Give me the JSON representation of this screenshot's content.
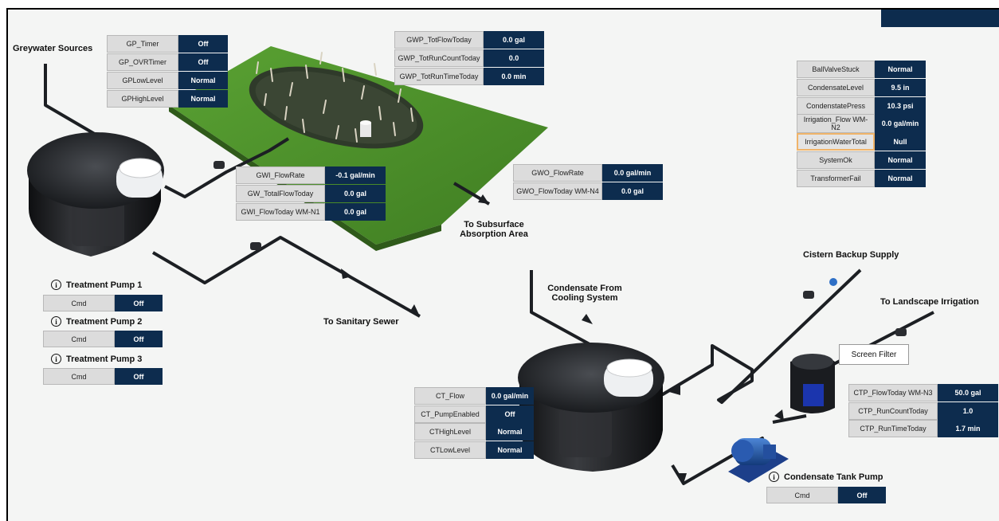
{
  "sources": {
    "greywater": "Greywater Sources",
    "sanitary": "To Sanitary Sewer",
    "subsurface_1": "To Subsurface",
    "subsurface_2": "Absorption Area",
    "condensate_1": "Condensate From",
    "condensate_2": "Cooling System",
    "cistern": "Cistern Backup Supply",
    "landscape": "To Landscape Irrigation",
    "screen_filter": "Screen Filter"
  },
  "gp_tags": [
    {
      "name": "GP_Timer",
      "value": "Off"
    },
    {
      "name": "GP_OVRTimer",
      "value": "Off"
    },
    {
      "name": "GPLowLevel",
      "value": "Normal"
    },
    {
      "name": "GPHighLevel",
      "value": "Normal"
    }
  ],
  "gwp_tags": [
    {
      "name": "GWP_TotFlowToday",
      "value": "0.0 gal"
    },
    {
      "name": "GWP_TotRunCountToday",
      "value": "0.0"
    },
    {
      "name": "GWP_TotRunTimeToday",
      "value": "0.0 min"
    }
  ],
  "gwi_tags": [
    {
      "name": "GWI_FlowRate",
      "value": "-0.1 gal/min"
    },
    {
      "name": "GW_TotalFlowToday",
      "value": "0.0 gal"
    },
    {
      "name": "GWI_FlowToday WM-N1",
      "value": "0.0 gal"
    }
  ],
  "gwo_tags": [
    {
      "name": "GWO_FlowRate",
      "value": "0.0 gal/min"
    },
    {
      "name": "GWO_FlowToday WM-N4",
      "value": "0.0 gal"
    }
  ],
  "system_tags": [
    {
      "name": "BallValveStuck",
      "value": "Normal"
    },
    {
      "name": "CondensateLevel",
      "value": "9.5 in"
    },
    {
      "name": "CondenstatePress",
      "value": "10.3 psi"
    },
    {
      "name": "Irrigation_Flow WM-N2",
      "value": "0.0 gal/min"
    },
    {
      "name": "IrrigationWaterTotal",
      "value": "Null"
    },
    {
      "name": "SystemOk",
      "value": "Normal"
    },
    {
      "name": "TransformerFail",
      "value": "Normal"
    }
  ],
  "ct_tags": [
    {
      "name": "CT_Flow",
      "value": "0.0 gal/min"
    },
    {
      "name": "CT_PumpEnabled",
      "value": "Off"
    },
    {
      "name": "CTHighLevel",
      "value": "Normal"
    },
    {
      "name": "CTLowLevel",
      "value": "Normal"
    }
  ],
  "ctp_tags": [
    {
      "name": "CTP_FlowToday WM-N3",
      "value": "50.0 gal"
    },
    {
      "name": "CTP_RunCountToday",
      "value": "1.0"
    },
    {
      "name": "CTP_RunTimeToday",
      "value": "1.7 min"
    }
  ],
  "pumps": [
    {
      "title": "Treatment Pump 1",
      "cmd": "Cmd",
      "state": "Off"
    },
    {
      "title": "Treatment Pump 2",
      "cmd": "Cmd",
      "state": "Off"
    },
    {
      "title": "Treatment Pump 3",
      "cmd": "Cmd",
      "state": "Off"
    },
    {
      "title": "Condensate Tank Pump",
      "cmd": "Cmd",
      "state": "Off"
    }
  ],
  "colors": {
    "value_bg": "#0d2c4e",
    "name_bg": "#dcdcdc",
    "highlight": "#f0b46a",
    "pipe": "#1c1f23"
  }
}
